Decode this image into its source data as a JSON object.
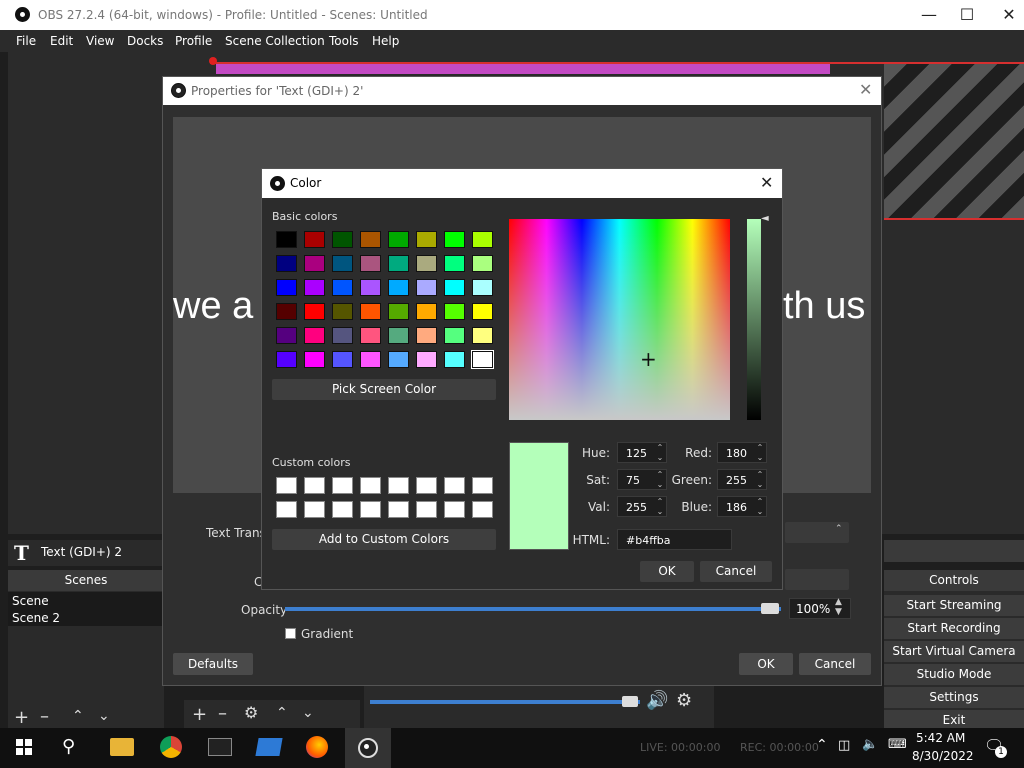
{
  "window": {
    "title": "OBS 27.2.4 (64-bit, windows) - Profile: Untitled - Scenes: Untitled"
  },
  "menu": [
    "File",
    "Edit",
    "View",
    "Docks",
    "Profile",
    "Scene Collection",
    "Tools",
    "Help"
  ],
  "preview": {
    "text_left": "we a",
    "text_right": "th us"
  },
  "source": {
    "name": "Text (GDI+) 2"
  },
  "scenes": {
    "header": "Scenes",
    "items": [
      "Scene",
      "Scene 2"
    ]
  },
  "controls": {
    "header": "Controls",
    "buttons": [
      "Start Streaming",
      "Start Recording",
      "Start Virtual Camera",
      "Studio Mode",
      "Settings",
      "Exit"
    ]
  },
  "props": {
    "title": "Properties for 'Text (GDI+) 2'",
    "text_transform_label": "Text Transf",
    "opacity_label": "Opacity",
    "opacity_value": "100%",
    "opacity_level": 1.0,
    "gradient_label": "Gradient",
    "defaults_label": "Defaults",
    "ok_label": "OK",
    "cancel_label": "Cancel",
    "c_label": "C"
  },
  "color_dialog": {
    "title": "Color",
    "basic_colors_label": "Basic colors",
    "basic_colors": [
      [
        "#000000",
        "#aa0000",
        "#005500",
        "#aa5500",
        "#00aa00",
        "#aaaa00",
        "#00ff00",
        "#aaff00"
      ],
      [
        "#000080",
        "#aa007f",
        "#00557f",
        "#aa557f",
        "#00aa7f",
        "#aaaa7f",
        "#00ff7f",
        "#aaff7f"
      ],
      [
        "#0000ff",
        "#aa00ff",
        "#0055ff",
        "#aa55ff",
        "#00aaff",
        "#aaaaff",
        "#00ffff",
        "#aaffff"
      ],
      [
        "#550000",
        "#ff0000",
        "#555500",
        "#ff5500",
        "#55aa00",
        "#ffaa00",
        "#55ff00",
        "#ffff00"
      ],
      [
        "#55007f",
        "#ff007f",
        "#55557f",
        "#ff557f",
        "#55aa7f",
        "#ffaa7f",
        "#55ff7f",
        "#ffff7f"
      ],
      [
        "#5500ff",
        "#ff00ff",
        "#5555ff",
        "#ff55ff",
        "#55aaff",
        "#ffaaff",
        "#55ffff",
        "#ffffff"
      ]
    ],
    "pick_screen_label": "Pick Screen Color",
    "custom_colors_label": "Custom colors",
    "add_custom_label": "Add to Custom Colors",
    "current_color": "#b4ffba",
    "fields": {
      "hue_label": "Hue:",
      "hue": "125",
      "sat_label": "Sat:",
      "sat": "75",
      "val_label": "Val:",
      "val": "255",
      "red_label": "Red:",
      "red": "180",
      "green_label": "Green:",
      "green": "255",
      "blue_label": "Blue:",
      "blue": "186",
      "html_label": "HTML:",
      "html": "#b4ffba"
    },
    "ok_label": "OK",
    "cancel_label": "Cancel"
  },
  "taskbar": {
    "time": "5:42 AM",
    "date": "8/30/2022",
    "live": "LIVE: 00:00:00",
    "rec": "REC: 00:00:00",
    "notifications": "1"
  }
}
